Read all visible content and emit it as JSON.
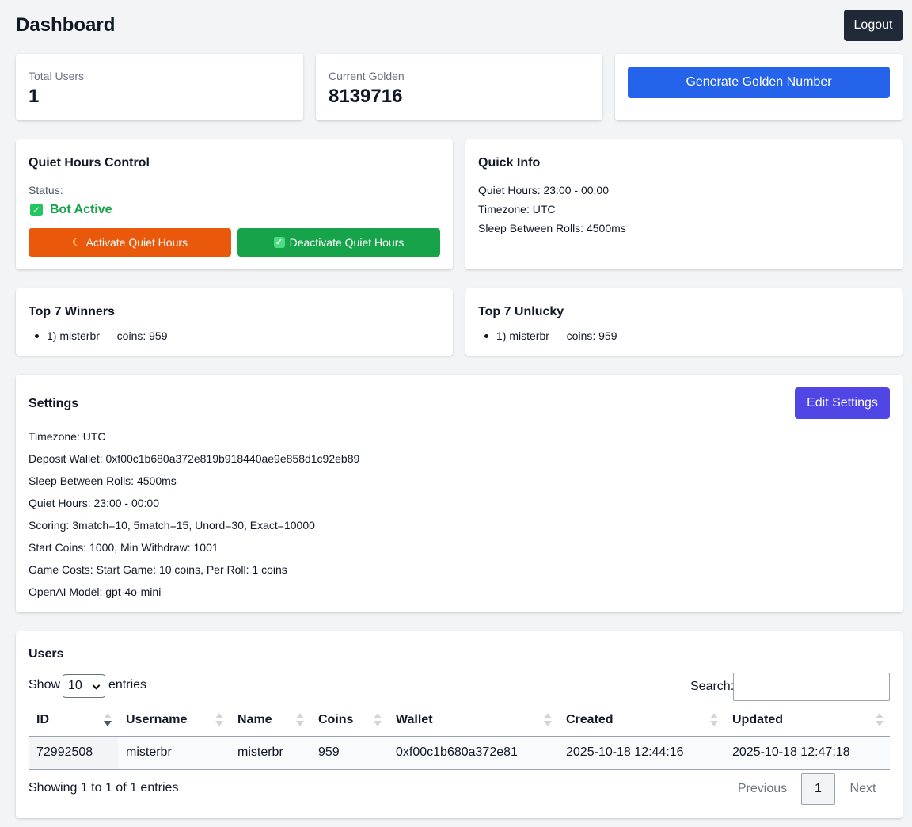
{
  "header": {
    "title": "Dashboard",
    "logout_label": "Logout"
  },
  "stats": {
    "total_users_label": "Total Users",
    "total_users_value": "1",
    "current_golden_label": "Current Golden",
    "current_golden_value": "8139716",
    "generate_button_label": "Generate Golden Number"
  },
  "quiet_hours": {
    "title": "Quiet Hours Control",
    "status_label": "Status:",
    "status_value": "Bot Active",
    "activate_label": "Activate Quiet Hours",
    "deactivate_label": "Deactivate Quiet Hours"
  },
  "quick_info": {
    "title": "Quick Info",
    "lines": [
      "Quiet Hours: 23:00 - 00:00",
      "Timezone: UTC",
      "Sleep Between Rolls: 4500ms"
    ]
  },
  "top_winners": {
    "title": "Top 7 Winners",
    "items": [
      "1) misterbr — coins: 959"
    ]
  },
  "top_unlucky": {
    "title": "Top 7 Unlucky",
    "items": [
      "1) misterbr — coins: 959"
    ]
  },
  "settings": {
    "title": "Settings",
    "edit_label": "Edit Settings",
    "lines": [
      "Timezone: UTC",
      "Deposit Wallet: 0xf00c1b680a372e819b918440ae9e858d1c92eb89",
      "Sleep Between Rolls: 4500ms",
      "Quiet Hours: 23:00 - 00:00",
      "Scoring: 3match=10, 5match=15, Unord=30, Exact=10000",
      "Start Coins: 1000, Min Withdraw: 1001",
      "Game Costs: Start Game: 10 coins, Per Roll: 1 coins",
      "OpenAI Model: gpt-4o-mini"
    ]
  },
  "users": {
    "title": "Users",
    "show_label": "Show",
    "entries_label": "entries",
    "page_size": "10",
    "search_label": "Search:",
    "search_value": "",
    "columns": [
      "ID",
      "Username",
      "Name",
      "Coins",
      "Wallet",
      "Created",
      "Updated"
    ],
    "rows": [
      [
        "72992508",
        "misterbr",
        "misterbr",
        "959",
        "0xf00c1b680a372e81",
        "2025-10-18 12:44:16",
        "2025-10-18 12:47:18"
      ]
    ],
    "info": "Showing 1 to 1 of 1 entries",
    "previous_label": "Previous",
    "current_page": "1",
    "next_label": "Next"
  },
  "colors": {
    "primary_blue": "#2563eb",
    "orange": "#ea580c",
    "green": "#16a34a",
    "indigo": "#4f46e5",
    "dark": "#1f2937",
    "status_green": "#16a34a"
  },
  "icons": {
    "activate": "crescent-moon-icon",
    "deactivate": "check-box-icon",
    "status": "check-box-icon"
  }
}
